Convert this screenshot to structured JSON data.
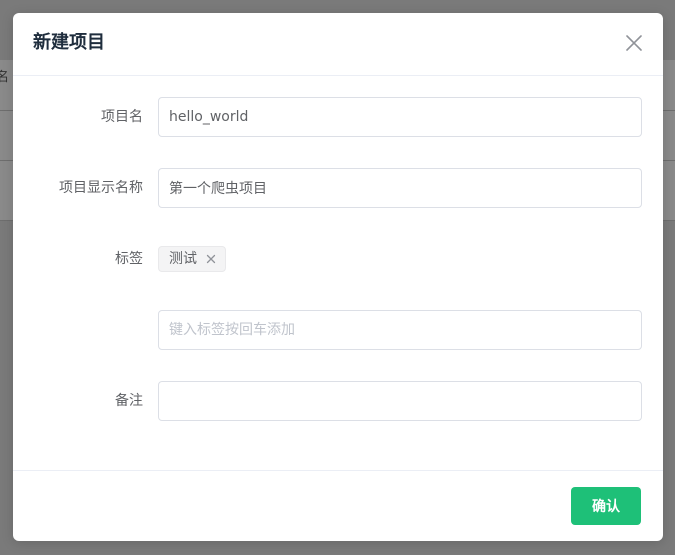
{
  "background": {
    "partial_text": "名"
  },
  "dialog": {
    "title": "新建项目",
    "close_icon": "close-icon",
    "fields": {
      "name": {
        "label": "项目名",
        "value": "hello_world"
      },
      "display_name": {
        "label": "项目显示名称",
        "value": "第一个爬虫项目"
      },
      "tags": {
        "label": "标签",
        "items": [
          "测试"
        ],
        "input_placeholder": "键入标签按回车添加"
      },
      "description": {
        "label": "备注",
        "value": ""
      }
    },
    "confirm_label": "确认"
  },
  "colors": {
    "accent": "#1ec078",
    "title": "#1f2d3d",
    "label": "#606266",
    "border": "#dcdfe6"
  }
}
